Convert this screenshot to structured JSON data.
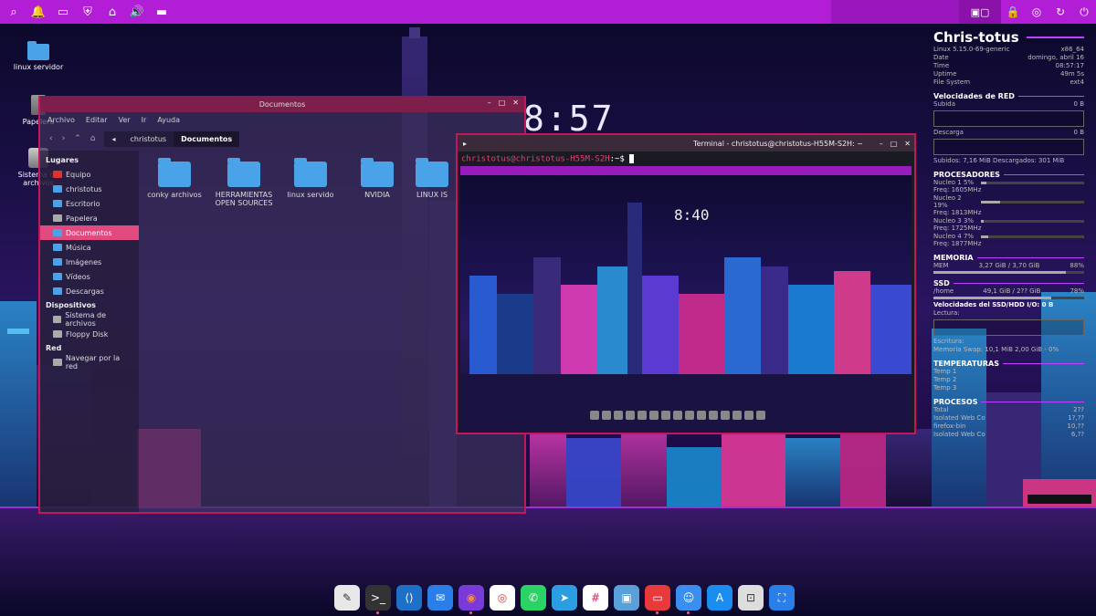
{
  "top_panel": {
    "left_icons": [
      "search-icon",
      "bell-icon",
      "inbox-icon",
      "shield-icon",
      "vpn-icon",
      "volume-icon",
      "folder-icon"
    ],
    "right_icons": [
      "workspace-icon",
      "lock-icon",
      "target-icon",
      "refresh-icon",
      "power-icon"
    ],
    "bg_color": "#b21ed6"
  },
  "desktop_icons": [
    {
      "label": "linux servidor",
      "icon": "folder-icon"
    },
    {
      "label": "Papelera",
      "icon": "trash-icon"
    },
    {
      "label": "Sistema de archivos",
      "icon": "drive-icon"
    }
  ],
  "big_clock": "8:57",
  "file_manager": {
    "title": "Documentos",
    "menu": [
      "Archivo",
      "Editar",
      "Ver",
      "Ir",
      "Ayuda"
    ],
    "breadcrumb": [
      "christotus",
      "Documentos"
    ],
    "sidebar": {
      "lugares_header": "Lugares",
      "lugares": [
        "Equipo",
        "christotus",
        "Escritorio",
        "Papelera",
        "Documentos",
        "Música",
        "Imágenes",
        "Vídeos",
        "Descargas"
      ],
      "selected": "Documentos",
      "dispositivos_header": "Dispositivos",
      "dispositivos": [
        "Sistema de archivos",
        "Floppy Disk"
      ],
      "red_header": "Red",
      "red": [
        "Navegar por la red"
      ]
    },
    "folders": [
      "conky archivos",
      "HERRAMIENTAS OPEN SOURCES",
      "linux servido",
      "NVIDIA",
      "LINUX IS"
    ]
  },
  "terminal": {
    "title": "Terminal - christotus@christotus-H55M-S2H: ~",
    "prompt_user": "christotus@christotus-H55M-S2H",
    "prompt_path": ":~$",
    "screenshot_clock": "8:40"
  },
  "conky": {
    "hostname": "Chris-totus",
    "system": [
      {
        "k": "Linux 5.15.0-69-generic",
        "v": "x86_64"
      },
      {
        "k": "Date",
        "v": "domingo, abril 16"
      },
      {
        "k": "Time",
        "v": "08:57:17"
      },
      {
        "k": "Uptime",
        "v": "49m 5s"
      },
      {
        "k": "File System",
        "v": "ext4"
      }
    ],
    "net_header": "Velocidades de RED",
    "net": [
      {
        "k": "Subida",
        "v": "0 B"
      },
      {
        "k": "Descarga",
        "v": "0 B"
      }
    ],
    "net_totals": "Subidos:   7,16 MiB Descargados:   301 MiB",
    "cpu_header": "PROCESADORES",
    "cpus": [
      {
        "label": "Nucleo 1 5%",
        "freq": "Freq: 1605MHz",
        "pct": 5
      },
      {
        "label": "Nucleo 2 19%",
        "freq": "Freq: 1813MHz",
        "pct": 19
      },
      {
        "label": "Nucleo 3 3%",
        "freq": "Freq: 1725MHz",
        "pct": 3
      },
      {
        "label": "Nucleo 4 7%",
        "freq": "Freq: 1877MHz",
        "pct": 7
      }
    ],
    "mem_header": "MEMORIA",
    "mem": {
      "k": "MEM",
      "mid": "3,27 GiB / 3,70 GiB",
      "v": "88%",
      "pct": 88
    },
    "ssd_header": "SSD",
    "ssd": {
      "k": "/home",
      "mid": "49,1 GiB / 2?? GiB",
      "v": "78%",
      "pct": 78
    },
    "ssd_speed_header": "Velocidades del SSD/HDD I/O: 0 B",
    "ssd_read": "Lectura:",
    "ssd_write": "Escritura:",
    "swap": "Memoria Swap: 10,1 MiB 2,00 GiB - 0%",
    "temp_header": "TEMPERATURAS",
    "temps": [
      "Temp 1",
      "Temp 2",
      "Temp 3"
    ],
    "proc_header": "PROCESOS",
    "procs": [
      {
        "k": "Total",
        "v": "2??"
      },
      {
        "k": "Isolated Web Co",
        "v": "1?,??"
      },
      {
        "k": "firefox-bin",
        "v": "10,??"
      },
      {
        "k": "Isolated Web Co",
        "v": "6,??"
      }
    ]
  },
  "dock": [
    {
      "name": "text-editor-icon",
      "bg": "#e8e8e8",
      "glyph": "✎",
      "color": "#333"
    },
    {
      "name": "terminal-icon",
      "bg": "#333333",
      "glyph": ">_",
      "color": "#fff"
    },
    {
      "name": "vscode-icon",
      "bg": "#1e6fc8",
      "glyph": "⟨⟩",
      "color": "#fff"
    },
    {
      "name": "mail-icon",
      "bg": "#2a7ee8",
      "glyph": "✉",
      "color": "#fff"
    },
    {
      "name": "firefox-icon",
      "bg": "#7a3ad8",
      "glyph": "◉",
      "color": "#ff8a2a"
    },
    {
      "name": "chrome-icon",
      "bg": "#ffffff",
      "glyph": "◎",
      "color": "#e33"
    },
    {
      "name": "whatsapp-icon",
      "bg": "#2bd366",
      "glyph": "✆",
      "color": "#fff"
    },
    {
      "name": "telegram-icon",
      "bg": "#2a9ee0",
      "glyph": "➤",
      "color": "#fff"
    },
    {
      "name": "slack-icon",
      "bg": "#ffffff",
      "glyph": "#",
      "color": "#e01e5a"
    },
    {
      "name": "screenshot-icon",
      "bg": "#5aa0d8",
      "glyph": "▣",
      "color": "#fff"
    },
    {
      "name": "presentation-icon",
      "bg": "#e83a3a",
      "glyph": "▭",
      "color": "#fff"
    },
    {
      "name": "finder-icon",
      "bg": "#3a8ef0",
      "glyph": "☺",
      "color": "#fff"
    },
    {
      "name": "appstore-icon",
      "bg": "#1a8ef0",
      "glyph": "A",
      "color": "#fff"
    },
    {
      "name": "camera-capture-icon",
      "bg": "#dddddd",
      "glyph": "⊡",
      "color": "#333"
    },
    {
      "name": "window-manager-icon",
      "bg": "#2a7ee8",
      "glyph": "⛶",
      "color": "#fff"
    }
  ]
}
